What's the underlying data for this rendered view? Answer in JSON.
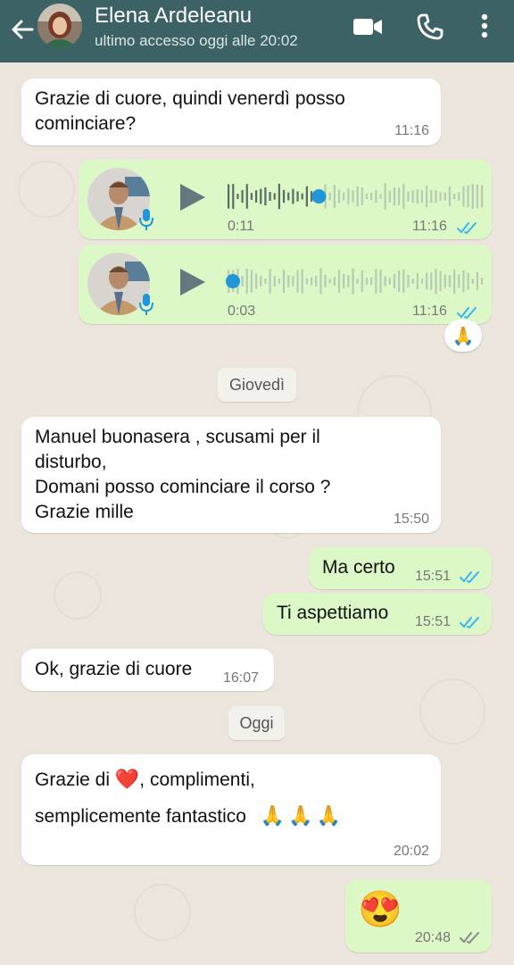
{
  "header": {
    "contact_name": "Elena Ardeleanu",
    "status": "ultimo accesso oggi alle 20:02",
    "icons": [
      "back-arrow-icon",
      "video-call-icon",
      "phone-icon",
      "more-vert-icon"
    ]
  },
  "messages": {
    "m1": {
      "text_line1": "Grazie di cuore, quindi venerdì  posso",
      "text_line2": "cominciare?",
      "time": "11:16"
    },
    "voice1": {
      "duration": "0:11",
      "time": "11:16",
      "progress": 0.36
    },
    "voice2": {
      "duration": "0:03",
      "time": "11:16",
      "progress": 0.0,
      "reaction": "🙏"
    },
    "day1": "Giovedì",
    "m2": {
      "line1": "Manuel buonasera , scusami per il",
      "line2": "disturbo,",
      "line3": "Domani posso cominciare il corso ?",
      "line4": "Grazie mille",
      "time": "15:50"
    },
    "m3": {
      "text": "Ma certo",
      "time": "15:51"
    },
    "m4": {
      "text": "Ti aspettiamo",
      "time": "15:51"
    },
    "m5": {
      "text": "Ok, grazie di cuore",
      "time": "16:07"
    },
    "day2": "Oggi",
    "m6": {
      "line1_a": "Grazie di ",
      "line1_heart": "❤️",
      "line1_b": ", complimenti,",
      "line2": "semplicemente fantastico",
      "emojis": "🙏🙏🙏",
      "time": "20:02"
    },
    "m7": {
      "emoji": "😍",
      "time": "20:48"
    }
  },
  "colors": {
    "header": "#3d6266",
    "outgoing_bubble": "#dcf8c6",
    "incoming_bubble": "#ffffff",
    "read_ticks": "#34b7f1",
    "voice_progress": "#2196d9"
  }
}
